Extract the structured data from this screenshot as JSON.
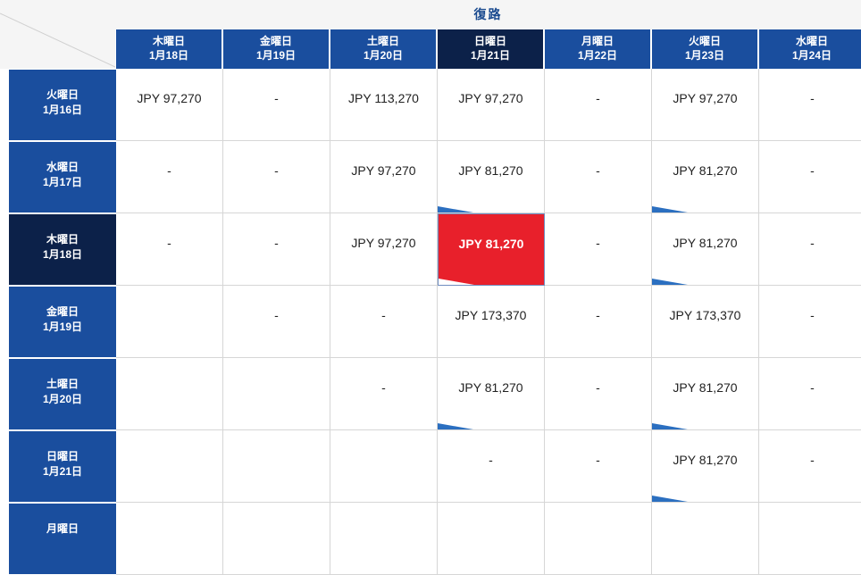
{
  "header": {
    "return_label": "復路"
  },
  "columns": [
    {
      "day": "木曜日",
      "date": "1月18日"
    },
    {
      "day": "金曜日",
      "date": "1月19日"
    },
    {
      "day": "土曜日",
      "date": "1月20日"
    },
    {
      "day": "日曜日",
      "date": "1月21日",
      "selected": true
    },
    {
      "day": "月曜日",
      "date": "1月22日"
    },
    {
      "day": "火曜日",
      "date": "1月23日"
    },
    {
      "day": "水曜日",
      "date": "1月24日"
    }
  ],
  "rows": [
    {
      "day": "火曜日",
      "date": "1月16日",
      "cells": [
        "JPY 97,270",
        "-",
        "JPY 113,270",
        "JPY 97,270",
        "-",
        "JPY 97,270",
        "-"
      ]
    },
    {
      "day": "水曜日",
      "date": "1月17日",
      "cells": [
        "-",
        "-",
        "JPY 97,270",
        "JPY 81,270",
        "-",
        "JPY 81,270",
        "-"
      ]
    },
    {
      "day": "木曜日",
      "date": "1月18日",
      "selected": true,
      "cells": [
        "-",
        "-",
        "JPY 97,270",
        "JPY 81,270",
        "-",
        "JPY 81,270",
        "-"
      ]
    },
    {
      "day": "金曜日",
      "date": "1月19日",
      "cells": [
        "",
        "-",
        "-",
        "JPY 173,370",
        "-",
        "JPY 173,370",
        "-"
      ]
    },
    {
      "day": "土曜日",
      "date": "1月20日",
      "cells": [
        "",
        "",
        "-",
        "JPY 81,270",
        "-",
        "JPY 81,270",
        "-"
      ]
    },
    {
      "day": "日曜日",
      "date": "1月21日",
      "cells": [
        "",
        "",
        "",
        "-",
        "-",
        "JPY 81,270",
        "-"
      ]
    },
    {
      "day": "月曜日",
      "date": "",
      "cells": [
        "",
        "",
        "",
        "",
        "",
        "",
        ""
      ]
    }
  ],
  "selected_cell": {
    "row": 2,
    "col": 3
  },
  "lowest_fare_markers": [
    [
      1,
      3
    ],
    [
      1,
      5
    ],
    [
      2,
      3
    ],
    [
      2,
      5
    ],
    [
      4,
      3
    ],
    [
      4,
      5
    ],
    [
      5,
      5
    ]
  ],
  "colors": {
    "header_blue": "#1a4e9e",
    "selected_navy": "#0c2149",
    "selected_fare_red": "#e8202b",
    "marker_blue": "#2b6fc0"
  }
}
